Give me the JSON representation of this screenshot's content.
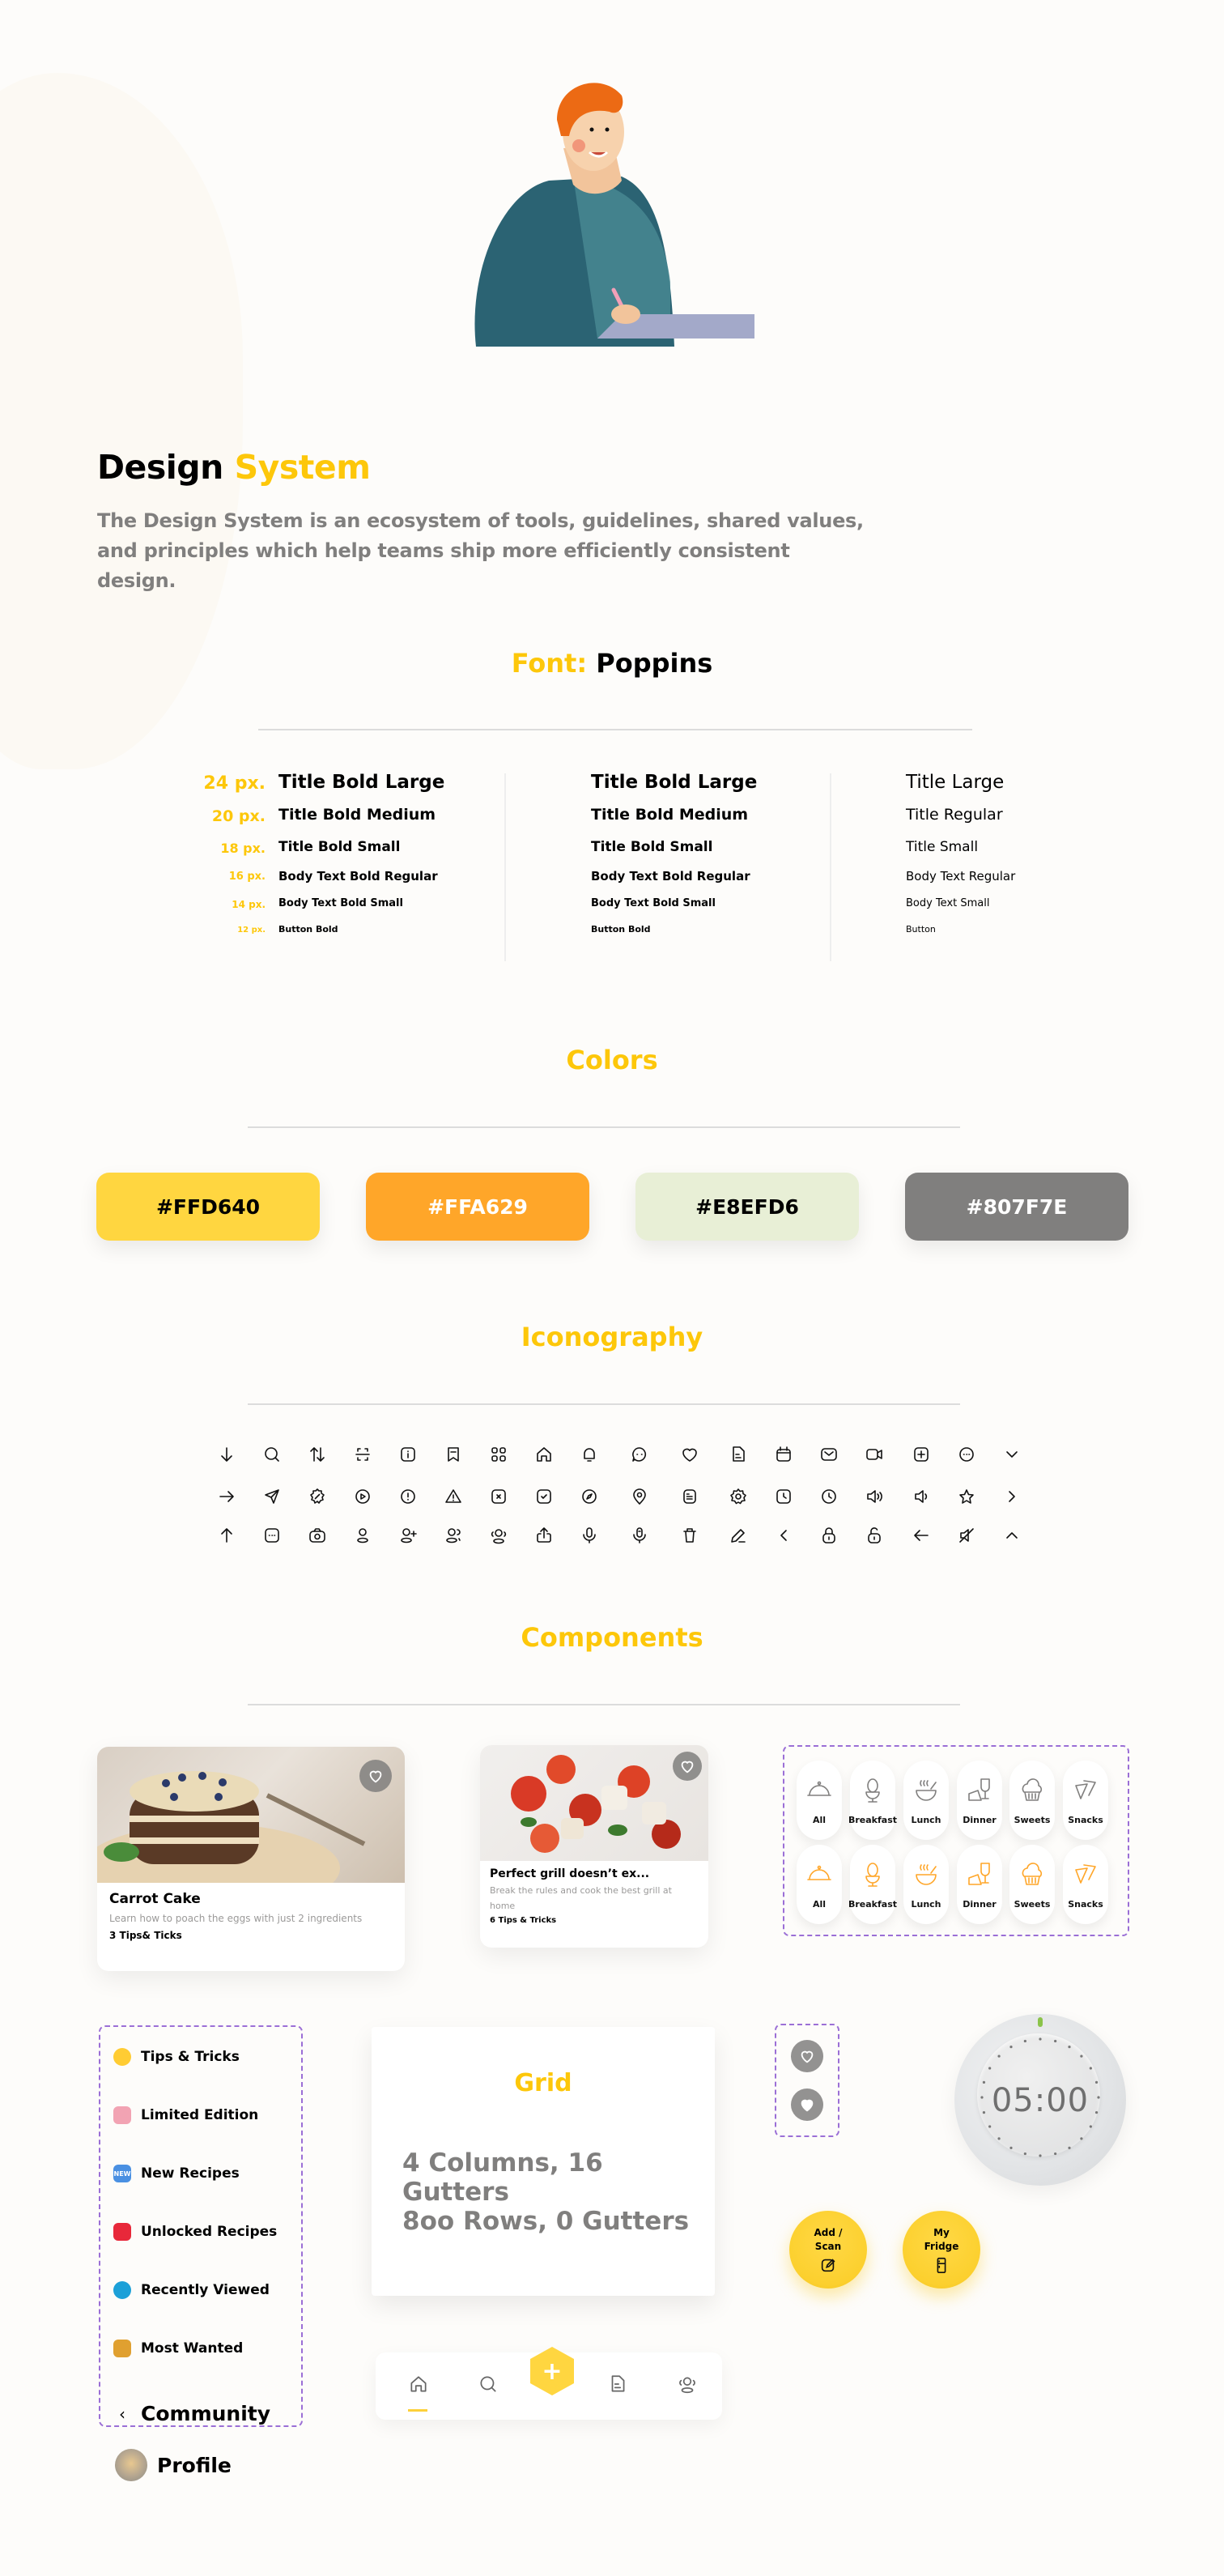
{
  "header": {
    "title_part1": "Design",
    "title_part2": "System",
    "description": "The Design System is an ecosystem of tools, guidelines, shared values, and principles which help teams ship more efficiently consistent design."
  },
  "font_section": {
    "label": "Font:",
    "font_name": "Poppins",
    "sizes": [
      "24 px.",
      "20 px.",
      "18 px.",
      "16 px.",
      "14 px.",
      "12 px."
    ],
    "column1": [
      "Title Bold Large",
      "Title Bold Medium",
      "Title Bold Small",
      "Body Text Bold Regular",
      "Body Text Bold Small",
      "Button Bold"
    ],
    "column2": [
      "Title Bold Large",
      "Title Bold Medium",
      "Title Bold Small",
      "Body Text Bold Regular",
      "Body Text Bold Small",
      "Button Bold"
    ],
    "column3": [
      "Title Large",
      "Title Regular",
      "Title Small",
      "Body Text Regular",
      "Body Text Small",
      "Button"
    ]
  },
  "colors_section": {
    "title": "Colors",
    "swatches": [
      {
        "hex": "#FFD640",
        "label": "#FFD640",
        "text_color": "#000000"
      },
      {
        "hex": "#FFA629",
        "label": "#FFA629",
        "text_color": "#ffffff"
      },
      {
        "hex": "#E8EFD6",
        "label": "#E8EFD6",
        "text_color": "#000000"
      },
      {
        "hex": "#807F7E",
        "label": "#807F7E",
        "text_color": "#ffffff"
      }
    ]
  },
  "iconography_section": {
    "title": "Iconography",
    "rows": [
      [
        "arrow-down-icon",
        "search-icon",
        "sort-icon",
        "scan-icon",
        "info-square-icon",
        "bookmark-icon",
        "grid-icon",
        "home-icon",
        "bell-icon",
        "chat-icon",
        "heart-icon",
        "document-icon",
        "calendar-icon",
        "mail-icon",
        "video-icon",
        "add-square-icon",
        "more-circle-icon",
        "chevron-down-icon"
      ],
      [
        "arrow-right-icon",
        "send-icon",
        "discount-icon",
        "play-circle-icon",
        "alert-circle-icon",
        "warning-icon",
        "close-square-icon",
        "check-square-icon",
        "compass-icon",
        "location-icon",
        "paper-icon",
        "settings-icon",
        "clock-square-icon",
        "clock-icon",
        "volume-up-icon",
        "volume-down-icon",
        "star-icon",
        "chevron-right-icon"
      ],
      [
        "arrow-up-icon",
        "more-square-icon",
        "camera-icon",
        "user-icon",
        "add-user-icon",
        "users-icon",
        "community-icon",
        "upload-icon",
        "mic-icon",
        "mic-alt-icon",
        "trash-icon",
        "edit-icon",
        "chevron-left-icon",
        "lock-icon",
        "unlock-icon",
        "arrow-left-icon",
        "volume-off-icon",
        "chevron-up-icon"
      ]
    ]
  },
  "components_section": {
    "title": "Components",
    "cards": [
      {
        "title": "Carrot Cake",
        "description": "Learn how to poach the eggs with just 2 ingredients",
        "meta": "3 Tips& Ticks"
      },
      {
        "title": "Perfect grill doesn’t ex...",
        "description": "Break the rules and cook the best grill at home",
        "meta": "6 Tips & Tricks"
      }
    ],
    "categories": [
      "All",
      "Breakfast",
      "Lunch",
      "Dinner",
      "Sweets",
      "Snacks"
    ],
    "category_colors": {
      "default": "#807f7e",
      "active": "#ffa629"
    },
    "menu": {
      "items": [
        {
          "label": "Tips & Tricks",
          "icon": "lightbulb-icon"
        },
        {
          "label": "Limited Edition",
          "icon": "limited-badge-icon"
        },
        {
          "label": "New Recipes",
          "icon": "new-badge-icon",
          "badge": "NEW"
        },
        {
          "label": "Unlocked Recipes",
          "icon": "gift-icon"
        },
        {
          "label": "Recently Viewed",
          "icon": "history-icon"
        },
        {
          "label": "Most Wanted",
          "icon": "wanted-poster-icon"
        }
      ],
      "community_label": "Community",
      "profile_label": "Profile"
    },
    "grid": {
      "title": "Grid",
      "line1": "4 Columns, 16 Gutters",
      "line2": "8oo Rows, 0 Gutters"
    },
    "tabbar": {
      "tabs": [
        "home-icon",
        "search-icon",
        "add-icon",
        "document-icon",
        "community-icon"
      ],
      "active_index": 0,
      "fab_label": "+"
    },
    "buttons": {
      "add_scan": "Add / Scan",
      "my_fridge": "My Fridge"
    },
    "timer": {
      "value": "05:00"
    }
  }
}
